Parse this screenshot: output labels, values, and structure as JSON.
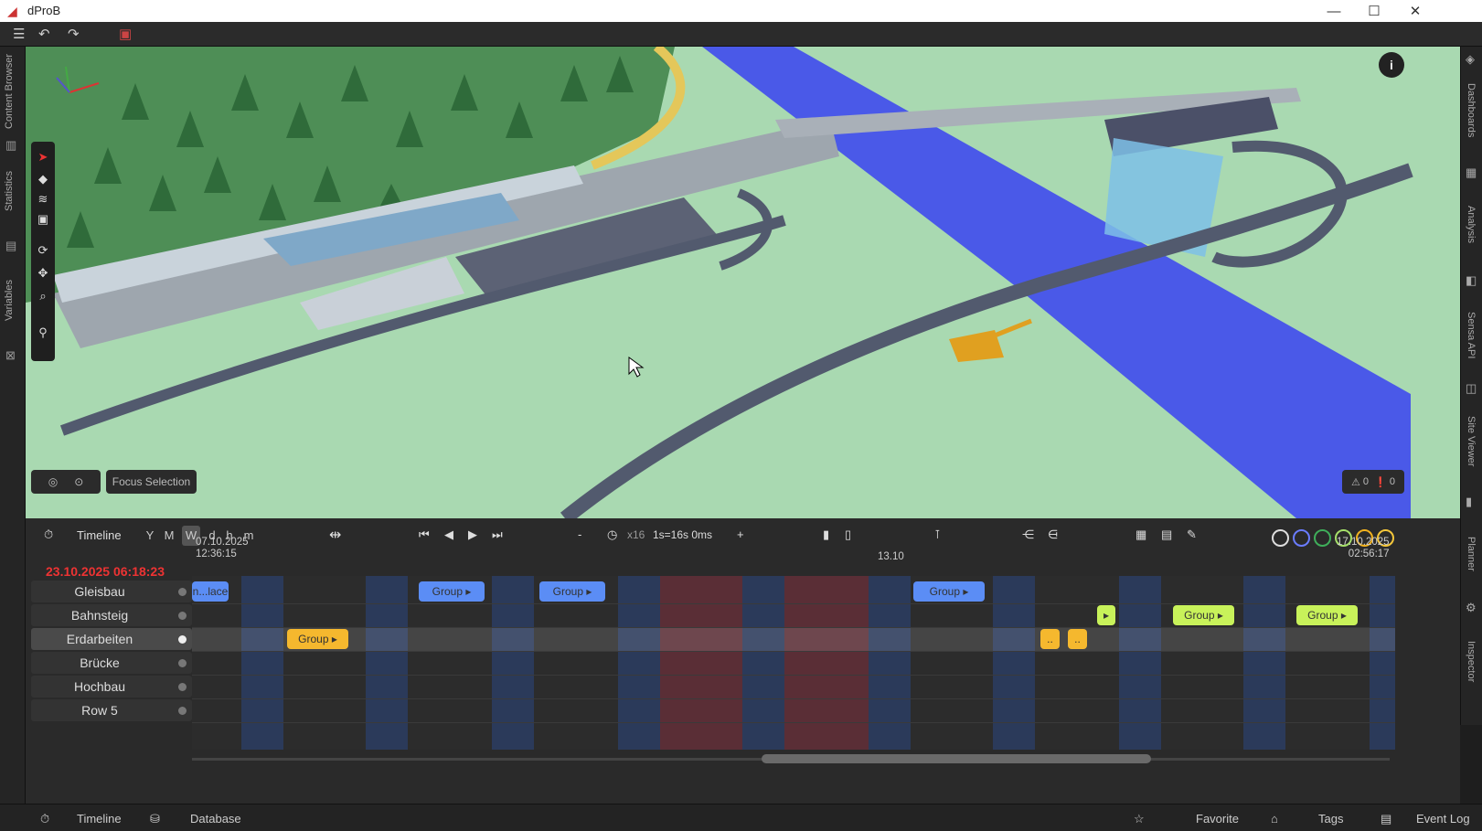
{
  "app": {
    "title": "dProB"
  },
  "toolbar": {
    "menu_icon": "☰",
    "undo_icon": "↶",
    "redo_icon": "↷",
    "save_icon": "▣"
  },
  "left_tabs": [
    "Content Browser",
    "Statistics",
    "Variables"
  ],
  "right_tabs": [
    "Dashboards",
    "Analysis",
    "Sensa API",
    "Site Viewer",
    "Planner",
    "Inspector"
  ],
  "viewport": {
    "focus_selection_label": "Focus Selection",
    "warning_count": "0",
    "error_count": "0",
    "info_icon": "i"
  },
  "timeline": {
    "title": "Timeline",
    "scales": [
      "Y",
      "M",
      "W",
      "d",
      "h",
      "m"
    ],
    "active_scale": "W",
    "speed_minus": "-",
    "speed_multiplier": "x16",
    "speed_value": "1s=16s 0ms",
    "speed_plus": "+",
    "current_datetime": "23.10.2025 06:18:23",
    "start_date": "07.10.2025",
    "start_time": "12:36:15",
    "mid_date": "13.10",
    "end_date": "17.10.2025",
    "end_time": "02:56:17",
    "rows": [
      "Gleisbau",
      "Bahnsteig",
      "Erdarbeiten",
      "Brücke",
      "Hochbau",
      "Row 5"
    ],
    "selected_row": "Erdarbeiten",
    "circle_colors": [
      "#dddddd",
      "#6a7cff",
      "#3fae5a",
      "#a6e06a",
      "#f2b21f",
      "#f5c73b"
    ],
    "chips": [
      {
        "label": "n...lace",
        "color": "#5b8df5"
      },
      {
        "label": "Group",
        "color": "#5b8df5"
      },
      {
        "label": "Group",
        "color": "#5b8df5"
      },
      {
        "label": "Group",
        "color": "#5b8df5"
      },
      {
        "label": "▸",
        "color": "#c8f25a"
      },
      {
        "label": "Group",
        "color": "#c8f25a"
      },
      {
        "label": "Group",
        "color": "#c8f25a"
      },
      {
        "label": "Group",
        "color": "#f5b82e"
      },
      {
        "label": "..",
        "color": "#f5b82e"
      },
      {
        "label": "..",
        "color": "#f5b82e"
      }
    ]
  },
  "bottom_tabs": {
    "timeline": "Timeline",
    "database": "Database",
    "favorite": "Favorite",
    "tags": "Tags",
    "event_log": "Event Log"
  }
}
